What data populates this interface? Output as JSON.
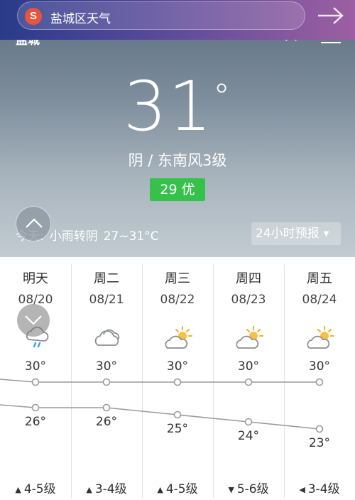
{
  "search": {
    "query": "盐城区天气",
    "logo_letter": "S"
  },
  "header": {
    "city_partial": "盐城"
  },
  "current": {
    "temperature": "31",
    "degree_symbol": "°",
    "condition": "阴  /  东南风3级",
    "aqi": "29 优",
    "today_label": "今天:",
    "today_weather": "小雨转阴",
    "today_range": "27~31°C",
    "hourly_button": "24小时预报"
  },
  "forecast": [
    {
      "day": "明天",
      "date": "08/20",
      "icon": "rain-cloud-icon",
      "high": "30°",
      "low": "26°",
      "high_v": 30,
      "low_v": 26,
      "wind": "4-5级",
      "wind_dir": "northeast-arrow"
    },
    {
      "day": "周二",
      "date": "08/21",
      "icon": "cloud-icon",
      "high": "30°",
      "low": "26°",
      "high_v": 30,
      "low_v": 26,
      "wind": "3-4级",
      "wind_dir": "northeast-arrow"
    },
    {
      "day": "周三",
      "date": "08/22",
      "icon": "sun-cloud-icon",
      "high": "30°",
      "low": "25°",
      "high_v": 30,
      "low_v": 25,
      "wind": "4-5级",
      "wind_dir": "northeast-arrow"
    },
    {
      "day": "周四",
      "date": "08/23",
      "icon": "sun-cloud-icon",
      "high": "30°",
      "low": "24°",
      "high_v": 30,
      "low_v": 24,
      "wind": "5-6级",
      "wind_dir": "south-arrow"
    },
    {
      "day": "周五",
      "date": "08/24",
      "icon": "sun-cloud-icon",
      "high": "30°",
      "low": "23°",
      "high_v": 30,
      "low_v": 23,
      "wind": "3-4级",
      "wind_dir": "southwest-arrow"
    }
  ],
  "colors": {
    "aqi_good": "#35c14a",
    "line": "#9a9a9a"
  }
}
